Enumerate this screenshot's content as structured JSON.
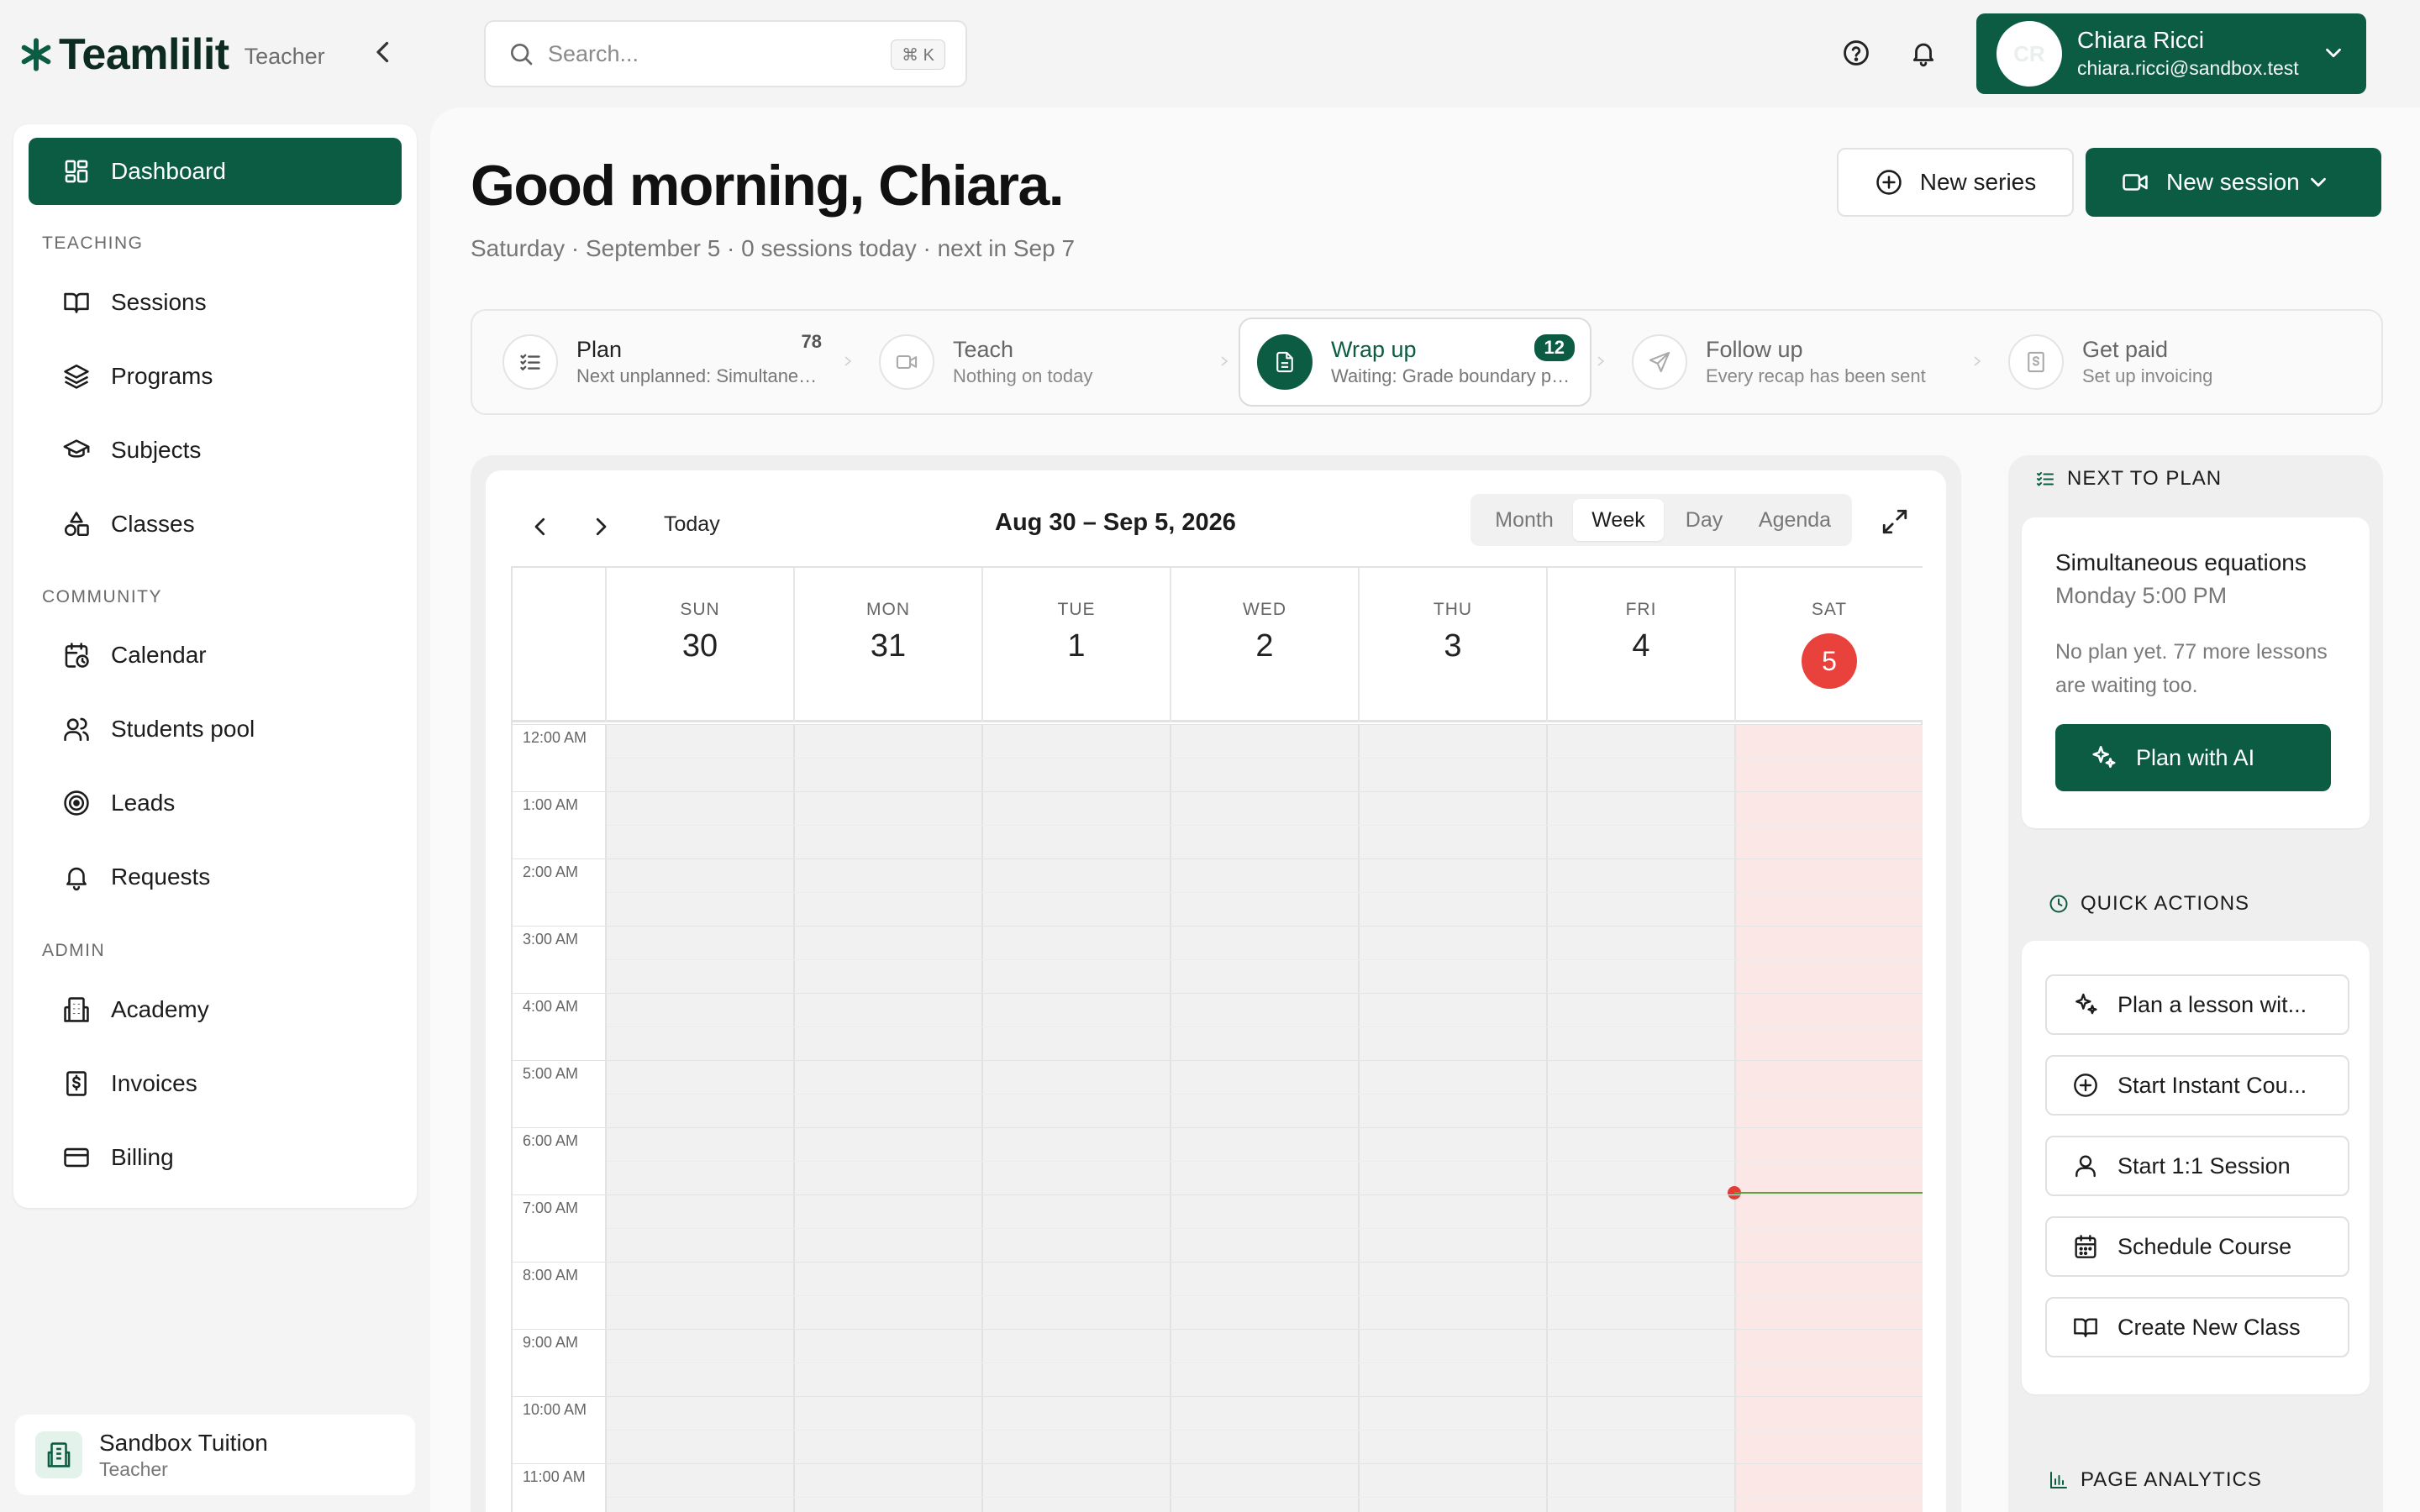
{
  "app": {
    "brand": "Teamlilit",
    "role": "Teacher"
  },
  "search": {
    "placeholder": "Search...",
    "shortcut": "⌘ K"
  },
  "user": {
    "initials": "CR",
    "name": "Chiara Ricci",
    "email": "chiara.ricci@sandbox.test"
  },
  "sidebar": {
    "dashboard": "Dashboard",
    "sections": {
      "teaching": "TEACHING",
      "community": "COMMUNITY",
      "admin": "ADMIN"
    },
    "items": {
      "sessions": "Sessions",
      "programs": "Programs",
      "subjects": "Subjects",
      "classes": "Classes",
      "calendar": "Calendar",
      "students_pool": "Students pool",
      "leads": "Leads",
      "requests": "Requests",
      "academy": "Academy",
      "invoices": "Invoices",
      "billing": "Billing"
    },
    "org": {
      "name": "Sandbox Tuition",
      "role": "Teacher"
    }
  },
  "header": {
    "greeting": "Good morning, Chiara.",
    "subline": "Saturday · September 5 · 0 sessions today · next in Sep 7",
    "new_series": "New series",
    "new_session": "New session"
  },
  "steps": [
    {
      "title": "Plan",
      "subtitle": "Next unplanned: Simultaneo...",
      "count": "78"
    },
    {
      "title": "Teach",
      "subtitle": "Nothing on today",
      "count": ""
    },
    {
      "title": "Wrap up",
      "subtitle": "Waiting: Grade boundary pu...",
      "count": "12"
    },
    {
      "title": "Follow up",
      "subtitle": "Every recap has been sent",
      "count": ""
    },
    {
      "title": "Get paid",
      "subtitle": "Set up invoicing",
      "count": ""
    }
  ],
  "calendar": {
    "today_label": "Today",
    "range": "Aug 30 – Sep 5, 2026",
    "views": [
      "Month",
      "Week",
      "Day",
      "Agenda"
    ],
    "active_view": "Week",
    "days": [
      {
        "dow": "SUN",
        "num": "30"
      },
      {
        "dow": "MON",
        "num": "31"
      },
      {
        "dow": "TUE",
        "num": "1"
      },
      {
        "dow": "WED",
        "num": "2"
      },
      {
        "dow": "THU",
        "num": "3"
      },
      {
        "dow": "FRI",
        "num": "4"
      },
      {
        "dow": "SAT",
        "num": "5"
      }
    ],
    "hours": [
      "12:00 AM",
      "1:00 AM",
      "2:00 AM",
      "3:00 AM",
      "4:00 AM",
      "5:00 AM",
      "6:00 AM",
      "7:00 AM",
      "8:00 AM",
      "9:00 AM",
      "10:00 AM",
      "11:00 AM"
    ]
  },
  "next_to_plan": {
    "heading": "NEXT TO PLAN",
    "title": "Simultaneous equations",
    "time": "Monday 5:00 PM",
    "note": "No plan yet. 77 more lessons are waiting too.",
    "button": "Plan with AI"
  },
  "quick_actions": {
    "heading": "QUICK ACTIONS",
    "items": [
      "Plan a lesson wit...",
      "Start Instant Cou...",
      "Start 1:1 Session",
      "Schedule Course",
      "Create New Class"
    ]
  },
  "page_analytics": {
    "heading": "PAGE ANALYTICS"
  },
  "colors": {
    "brand": "#0c5c43",
    "today": "#e9423c",
    "today_column": "#fbe8e6"
  }
}
